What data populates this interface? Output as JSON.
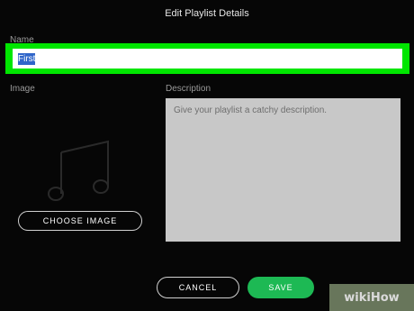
{
  "dialog": {
    "title": "Edit Playlist Details"
  },
  "name_field": {
    "label": "Name",
    "value": "First"
  },
  "image_section": {
    "label": "Image",
    "placeholder_icon": "music-note-icon",
    "choose_button": "CHOOSE IMAGE"
  },
  "description": {
    "label": "Description",
    "placeholder": "Give your playlist a catchy description."
  },
  "actions": {
    "cancel": "CANCEL",
    "save": "SAVE"
  },
  "watermark": "wikiHow",
  "colors": {
    "accent": "#1db954",
    "highlight": "#00e600",
    "selection": "#2f65c9"
  }
}
